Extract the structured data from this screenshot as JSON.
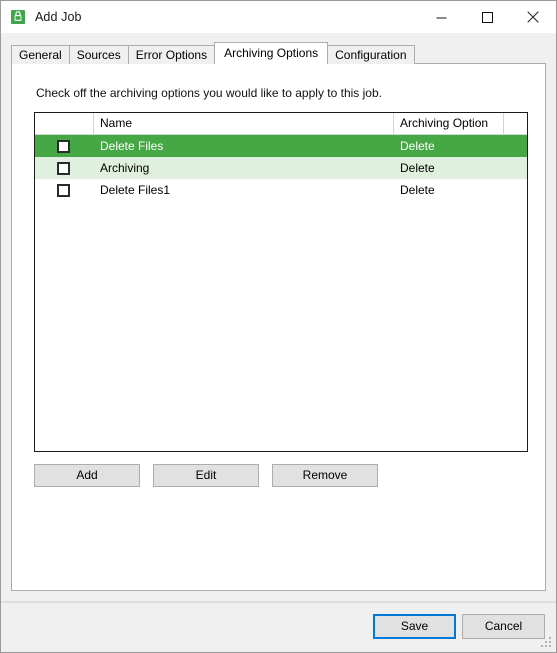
{
  "window": {
    "title": "Add Job",
    "icon": "app-green-lock-icon",
    "controls": {
      "minimize": "minimize-icon",
      "maximize": "maximize-icon",
      "close": "close-icon"
    }
  },
  "tabs": [
    {
      "label": "General",
      "active": false
    },
    {
      "label": "Sources",
      "active": false
    },
    {
      "label": "Error Options",
      "active": false
    },
    {
      "label": "Archiving Options",
      "active": true
    },
    {
      "label": "Configuration",
      "active": false
    }
  ],
  "content": {
    "instruction": "Check off the archiving options you would like to apply to this job."
  },
  "grid": {
    "columns": [
      "",
      "Name",
      "Archiving Option",
      ""
    ],
    "rows": [
      {
        "checked": false,
        "name": "Delete Files",
        "option": "Delete",
        "state": "selected"
      },
      {
        "checked": false,
        "name": "Archiving",
        "option": "Delete",
        "state": "alt"
      },
      {
        "checked": false,
        "name": "Delete Files1",
        "option": "Delete",
        "state": "normal"
      }
    ]
  },
  "mid_buttons": {
    "add": "Add",
    "edit": "Edit",
    "remove": "Remove"
  },
  "footer": {
    "save": "Save",
    "cancel": "Cancel"
  },
  "colors": {
    "selected_row": "#45a845",
    "alt_row": "#dff0df",
    "accent_focus": "#0078d7",
    "button_face": "#e1e1e1",
    "dialog_face": "#f0f0f0"
  }
}
